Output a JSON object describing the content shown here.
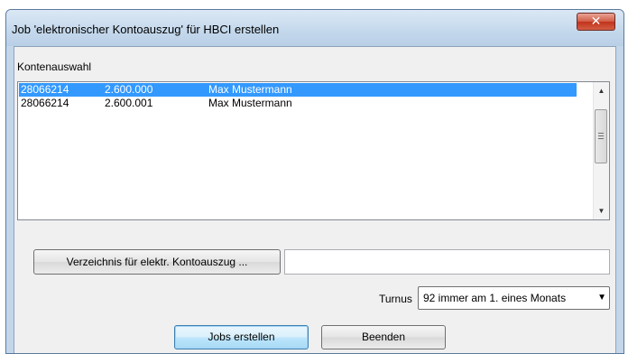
{
  "window": {
    "title": "Job 'elektronischer Kontoauszug' für HBCI erstellen"
  },
  "account_selection": {
    "label": "Kontenauswahl",
    "rows": [
      {
        "account": "28066214",
        "subaccount": "2.600.000",
        "name": "Max Mustermann",
        "selected": true
      },
      {
        "account": "28066214",
        "subaccount": "2.600.001",
        "name": "Max Mustermann",
        "selected": false
      }
    ]
  },
  "directory": {
    "button_label": "Verzeichnis für elektr. Kontoauszug ...",
    "value": ""
  },
  "turnus": {
    "label": "Turnus",
    "selected": "92 immer am 1. eines Monats"
  },
  "buttons": {
    "create": "Jobs erstellen",
    "exit": "Beenden"
  }
}
